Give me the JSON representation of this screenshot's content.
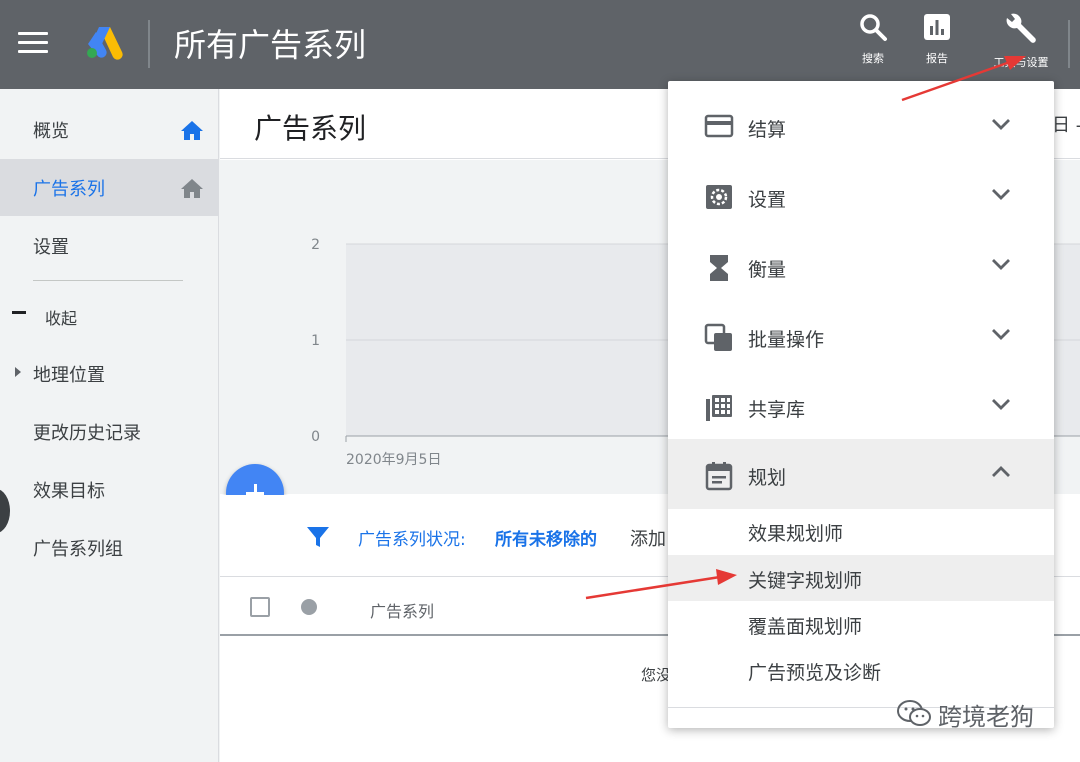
{
  "topbar": {
    "title": "所有广告系列",
    "tools": [
      {
        "label": "搜索",
        "icon": "search-icon"
      },
      {
        "label": "报告",
        "icon": "report-icon"
      },
      {
        "label": "工具与设置",
        "icon": "wrench-icon"
      }
    ]
  },
  "sidebar": {
    "items": [
      {
        "label": "概览"
      },
      {
        "label": "广告系列"
      },
      {
        "label": "设置"
      },
      {
        "label": "收起"
      },
      {
        "label": "地理位置"
      },
      {
        "label": "更改历史记录"
      },
      {
        "label": "效果目标"
      },
      {
        "label": "广告系列组"
      }
    ]
  },
  "main": {
    "title": "广告系列",
    "header_right": "日 -",
    "filter": {
      "label": "广告系列状况:",
      "value": "所有未移除的",
      "add": "添加"
    },
    "table": {
      "column": "广告系列",
      "empty_text": "您没"
    }
  },
  "chart_data": {
    "type": "line",
    "x": [
      "2020年9月5日"
    ],
    "series": [],
    "yticks": [
      "2",
      "1",
      "0"
    ],
    "ylim": [
      0,
      2
    ]
  },
  "dropdown": {
    "items": [
      {
        "label": "结算",
        "icon": "billing-card-icon"
      },
      {
        "label": "设置",
        "icon": "gear-icon"
      },
      {
        "label": "衡量",
        "icon": "hourglass-icon"
      },
      {
        "label": "批量操作",
        "icon": "bulk-copy-icon"
      },
      {
        "label": "共享库",
        "icon": "library-grid-icon"
      },
      {
        "label": "规划",
        "icon": "calendar-icon"
      }
    ],
    "subitems": [
      {
        "label": "效果规划师"
      },
      {
        "label": "关键字规划师"
      },
      {
        "label": "覆盖面规划师"
      },
      {
        "label": "广告预览及诊断"
      }
    ]
  },
  "watermark": {
    "text": "跨境老狗"
  },
  "colors": {
    "topbar": "#5f6368",
    "accent_blue": "#1a73e8",
    "fab_blue": "#4285f4",
    "arrow_red": "#e53935"
  }
}
